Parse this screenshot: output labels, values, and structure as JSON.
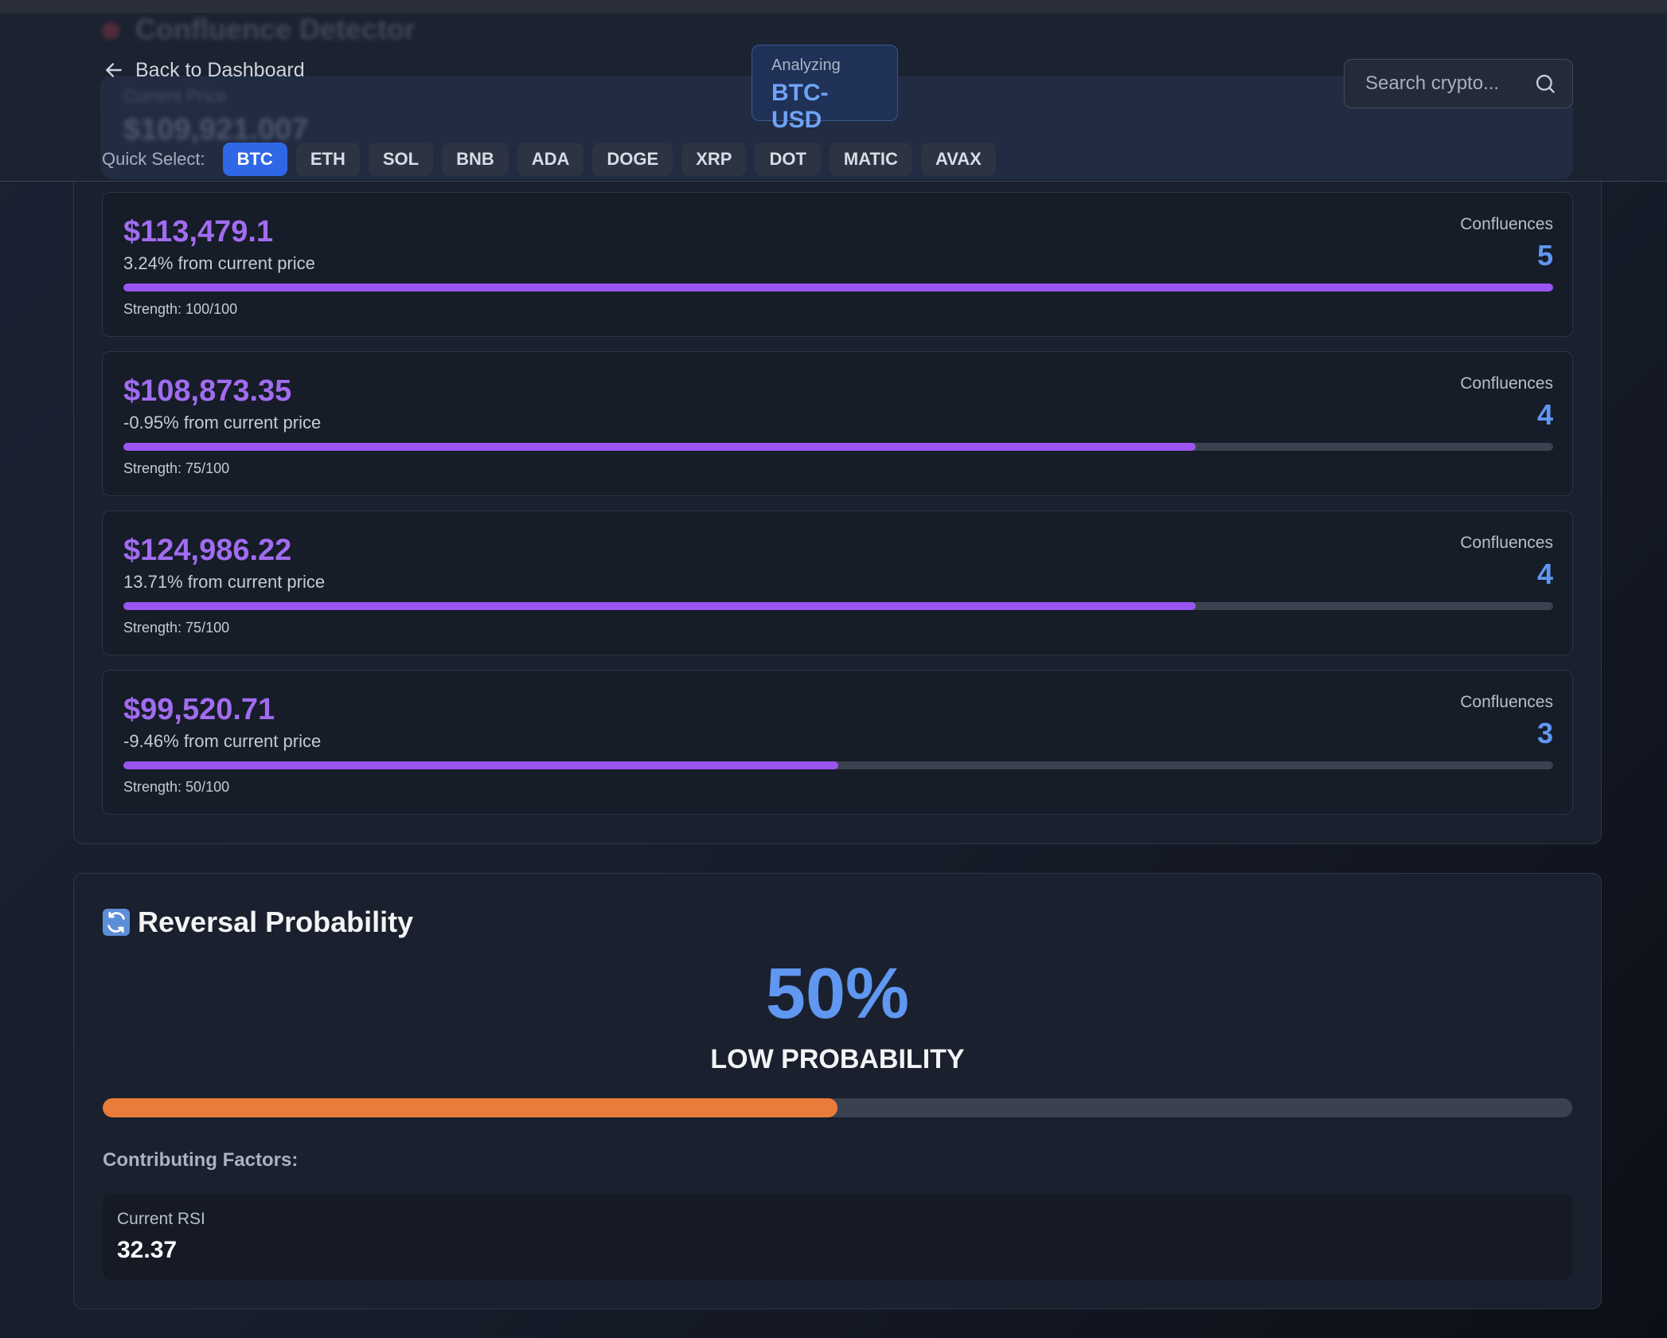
{
  "header": {
    "ghost_title": "Confluence Detector",
    "ghost_label": "Current Price",
    "ghost_price": "$109,921.007",
    "back_label": "Back to Dashboard",
    "analyzing_label": "Analyzing",
    "analyzing_symbol": "BTC-USD",
    "search_placeholder": "Search crypto...",
    "quick_select_label": "Quick Select:",
    "quick_select": [
      "BTC",
      "ETH",
      "SOL",
      "BNB",
      "ADA",
      "DOGE",
      "XRP",
      "DOT",
      "MATIC",
      "AVAX"
    ],
    "active_symbol": "BTC"
  },
  "zones": [
    {
      "price": "$113,479.1",
      "pct": "3.24% from current price",
      "conf_label": "Confluences",
      "conf": "5",
      "strength_text": "Strength: 100/100",
      "strength": 100
    },
    {
      "price": "$108,873.35",
      "pct": "-0.95% from current price",
      "conf_label": "Confluences",
      "conf": "4",
      "strength_text": "Strength: 75/100",
      "strength": 75
    },
    {
      "price": "$124,986.22",
      "pct": "13.71% from current price",
      "conf_label": "Confluences",
      "conf": "4",
      "strength_text": "Strength: 75/100",
      "strength": 75
    },
    {
      "price": "$99,520.71",
      "pct": "-9.46% from current price",
      "conf_label": "Confluences",
      "conf": "3",
      "strength_text": "Strength: 50/100",
      "strength": 50
    }
  ],
  "reversal": {
    "title": "Reversal Probability",
    "icon": "refresh-icon",
    "percent_text": "50%",
    "percent": 50,
    "level": "LOW PROBABILITY",
    "factors_title": "Contributing Factors:",
    "factors": [
      {
        "label": "Current RSI",
        "value": "32.37"
      }
    ]
  },
  "colors": {
    "accent_blue": "#5f97f1",
    "active_chip": "#2f68e6",
    "zone_price": "#a16cf0",
    "strength_fill": "#9a55f0",
    "reversal_fill": "#ea7c39"
  }
}
